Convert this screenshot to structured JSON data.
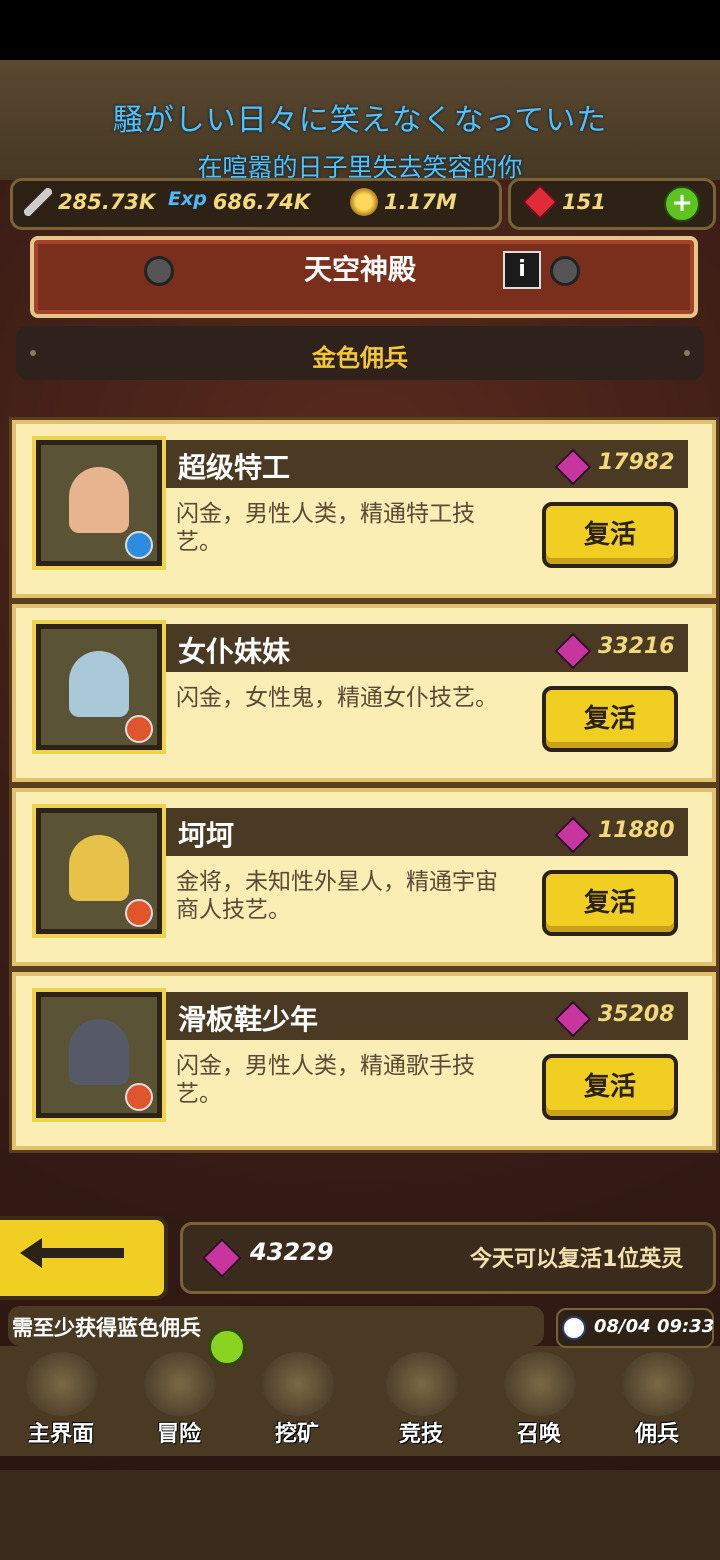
{
  "lyrics": {
    "line1": "騒がしい日々に笑えなくなっていた",
    "line2": "在喧嚣的日子里失去笑容的你"
  },
  "resources": {
    "attack": "285.73K",
    "exp_label": "Exp",
    "exp": "686.74K",
    "gold": "1.17M",
    "rubies": "151"
  },
  "header": {
    "title": "天空神殿",
    "info_label": "i",
    "subtitle": "金色佣兵"
  },
  "mercenaries": [
    {
      "name": "超级特工",
      "price": "17982",
      "desc": "闪金，男性人类，精通特工技艺。",
      "button": "复活",
      "fig_color": "#e8b48f",
      "badge_color": "#2c8de0"
    },
    {
      "name": "女仆妹妹",
      "price": "33216",
      "desc": "闪金，女性鬼，精通女仆技艺。",
      "button": "复活",
      "fig_color": "#a9c9d8",
      "badge_color": "#e0552c"
    },
    {
      "name": "坷坷",
      "price": "11880",
      "desc": "金将，未知性外星人，精通宇宙商人技艺。",
      "button": "复活",
      "fig_color": "#e6c24a",
      "badge_color": "#e0552c"
    },
    {
      "name": "滑板鞋少年",
      "price": "35208",
      "desc": "闪金，男性人类，精通歌手技艺。",
      "button": "复活",
      "fig_color": "#555a66",
      "badge_color": "#e0552c"
    }
  ],
  "footer": {
    "gem_total": "43229",
    "revive_note": "今天可以复活1位英灵",
    "ticker": "需至少获得蓝色佣兵",
    "datetime": "08/04 09:33"
  },
  "nav": [
    {
      "label": "主界面",
      "icon": "map-scroll-icon"
    },
    {
      "label": "冒险",
      "icon": "island-icon"
    },
    {
      "label": "挖矿",
      "icon": "pickaxe-icon"
    },
    {
      "label": "竞技",
      "icon": "crossed-swords-icon"
    },
    {
      "label": "召唤",
      "icon": "summon-scroll-icon"
    },
    {
      "label": "佣兵",
      "icon": "tent-icon"
    }
  ],
  "colors": {
    "accent_yellow": "#f0cf22",
    "lyric_blue": "#4fc3ff",
    "card_bg": "#fbeeb4",
    "banner_red": "#7a2f1c"
  }
}
